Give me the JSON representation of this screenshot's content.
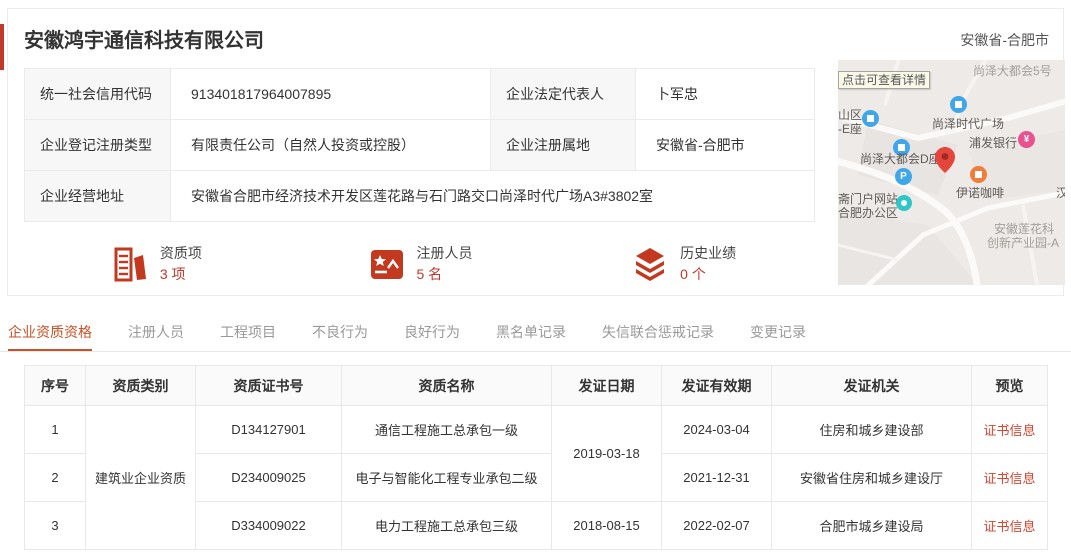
{
  "colors": {
    "accent": "#c75227",
    "brand_red": "#c0392b",
    "link_red": "#d9442f",
    "icon_red": "#c2391f"
  },
  "header": {
    "company_name": "安徽鸿宇通信科技有限公司",
    "region": "安徽省-合肥市"
  },
  "info": {
    "credit_code_label": "统一社会信用代码",
    "credit_code": "913401817964007895",
    "legal_rep_label": "企业法定代表人",
    "legal_rep": "卜军忠",
    "reg_type_label": "企业登记注册类型",
    "reg_type": "有限责任公司（自然人投资或控股）",
    "reg_region_label": "企业注册属地",
    "reg_region": "安徽省-合肥市",
    "address_label": "企业经营地址",
    "address": "安徽省合肥市经济技术开发区莲花路与石门路交口尚泽时代广场A3#3802室"
  },
  "stats": [
    {
      "icon": "building-icon",
      "label": "资质项",
      "value": "3 项"
    },
    {
      "icon": "certificate-icon",
      "label": "注册人员",
      "value": "5 名"
    },
    {
      "icon": "layers-icon",
      "label": "历史业绩",
      "value": "0 个"
    }
  ],
  "map": {
    "tooltip": "点击可查看详情",
    "labels": {
      "metro5": "尚泽大都会5号",
      "district": "山区",
      "e_block": "-E座",
      "times_square": "尚泽时代广场",
      "bank": "浦发银行",
      "metro_d": "尚泽大都会D座",
      "coffee": "伊诺咖啡",
      "han": "汉",
      "portal": "斋门户网站",
      "office": "合肥办公区",
      "lotus1": "安徽莲花科",
      "lotus2": "创新产业园-A"
    },
    "poi_glyphs": {
      "bank": "¥",
      "parking": "P"
    }
  },
  "tabs": [
    "企业资质资格",
    "注册人员",
    "工程项目",
    "不良行为",
    "良好行为",
    "黑名单记录",
    "失信联合惩戒记录",
    "变更记录"
  ],
  "cert_table": {
    "headers": [
      "序号",
      "资质类别",
      "资质证书号",
      "资质名称",
      "发证日期",
      "发证有效期",
      "发证机关",
      "预览"
    ],
    "category": "建筑业企业资质",
    "shared_issue_date": "2019-03-18",
    "rows": [
      {
        "no": "1",
        "cert_no": "D134127901",
        "name": "通信工程施工总承包一级",
        "valid_until": "2024-03-04",
        "authority": "住房和城乡建设部",
        "preview": "证书信息"
      },
      {
        "no": "2",
        "cert_no": "D234009025",
        "name": "电子与智能化工程专业承包二级",
        "valid_until": "2021-12-31",
        "authority": "安徽省住房和城乡建设厅",
        "preview": "证书信息"
      },
      {
        "no": "3",
        "cert_no": "D334009022",
        "name": "电力工程施工总承包三级",
        "issue_date": "2018-08-15",
        "valid_until": "2022-02-07",
        "authority": "合肥市城乡建设局",
        "preview": "证书信息"
      }
    ]
  }
}
